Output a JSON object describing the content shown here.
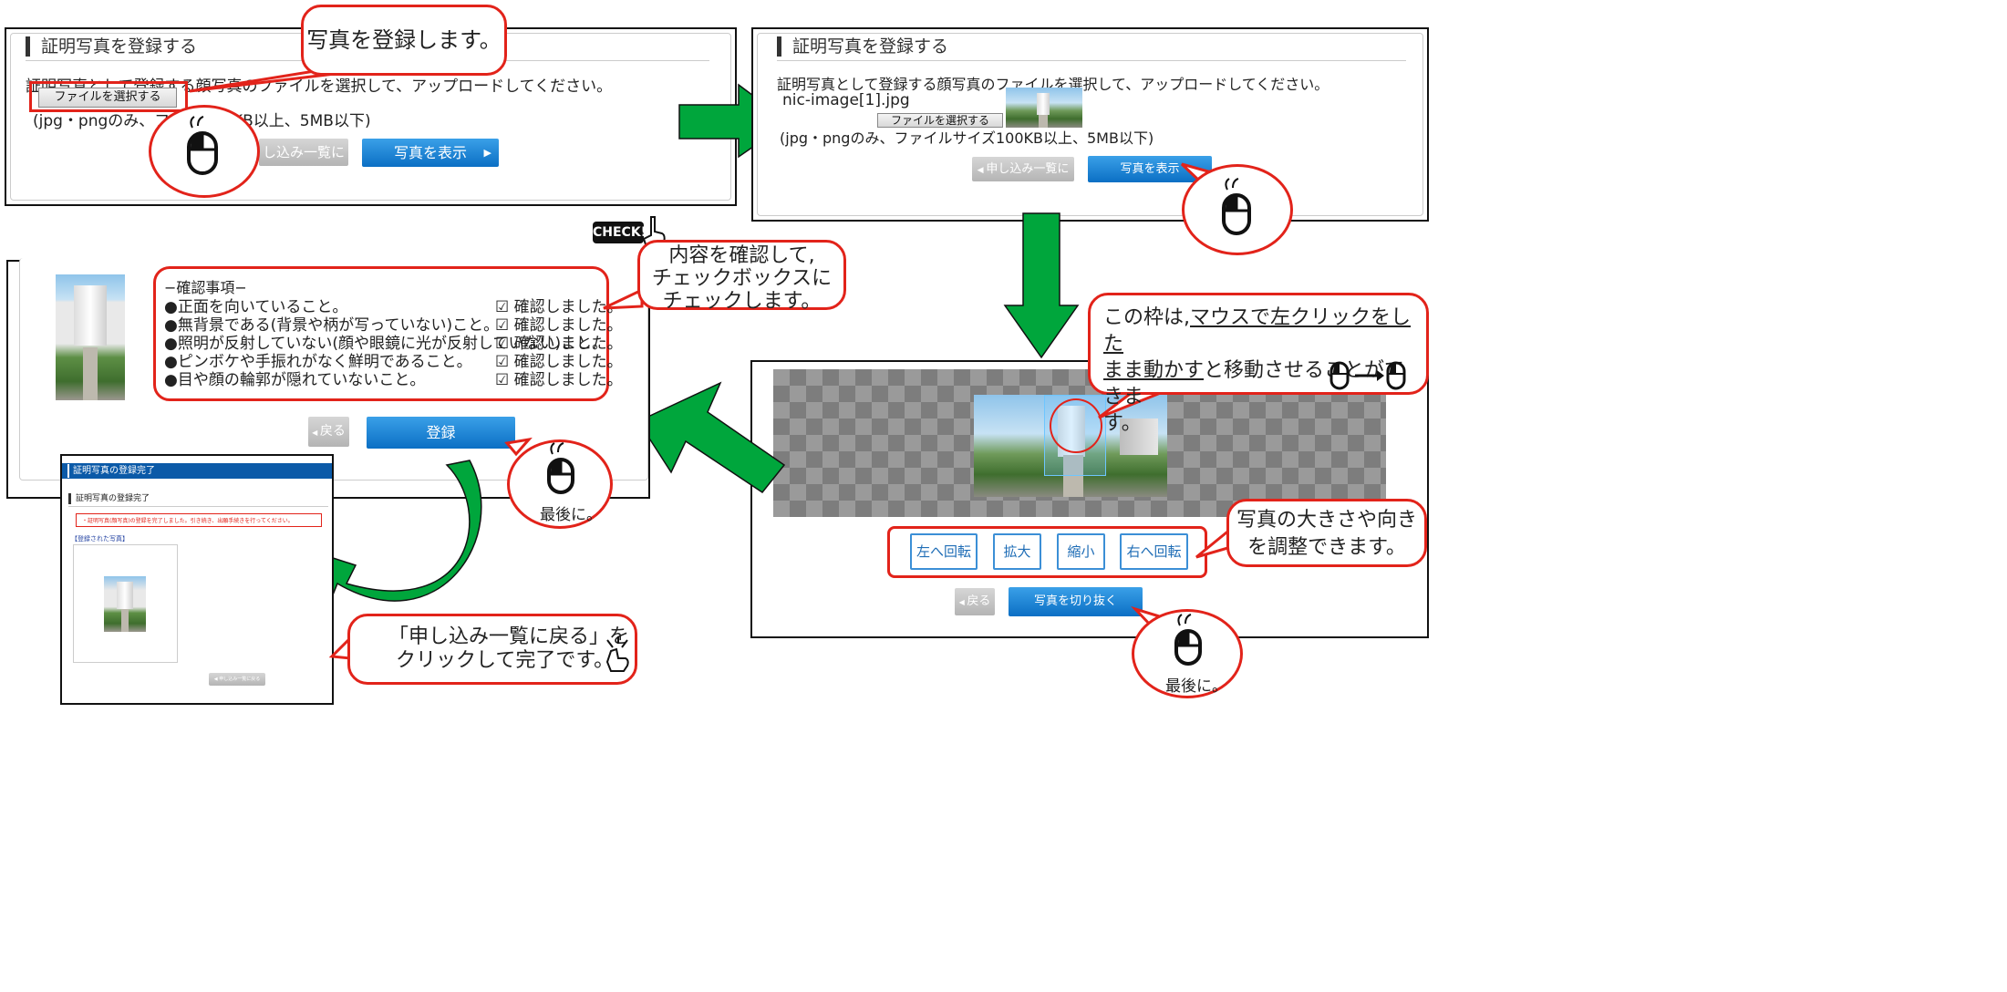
{
  "colors": {
    "callout_border": "#e2231a",
    "arrow_green": "#00a63c",
    "button_blue": "#0b6fc4"
  },
  "step1": {
    "title": "証明写真を登録する",
    "instruction": "証明写真として登録する顔写真のファイルを選択して、アップロードしてください。",
    "file_button": "ファイルを選択する",
    "hint": "(jpg・pngのみ、ファイ",
    "hint_tail": "KB以上、5MB以下)",
    "back_button": "し込み一覧に戻る",
    "show_button": "写真を表示",
    "callout": "写真を登録します。"
  },
  "step2": {
    "title": "証明写真を登録する",
    "instruction": "証明写真として登録する顔写真のファイルを選択して、アップロードしてください。",
    "filename": "nic-image[1].jpg",
    "file_button": "ファイルを選択する",
    "hint": "(jpg・pngのみ、ファイルサイズ100KB以上、5MB以下)",
    "back_button": "申し込み一覧に戻る",
    "show_button": "写真を表示"
  },
  "step3": {
    "callout": "この枠は,マウスで左クリックをしたまま動かすと移動させることができます。",
    "callout_lines": [
      "この枠は,",
      "マウスで左クリックをした",
      "まま動かす",
      "と移動させることができま",
      "す。"
    ],
    "buttons": [
      "左へ回転",
      "拡大",
      "縮小",
      "右へ回転"
    ],
    "adjust_callout": [
      "写真の大きさや向き",
      "を調整できます。"
    ],
    "back_button": "戻る",
    "crop_button": "写真を切り抜く",
    "last_label": "最後に。"
  },
  "step4": {
    "check_badge": "CHECK!",
    "callout": [
      "内容を確認して,",
      "チェックボックスに",
      "チェックします。"
    ],
    "heading": "−確認事項−",
    "items": [
      "●正面を向いていること。",
      "●無背景である(背景や柄が写っていない)こと。",
      "●照明が反射していない(顔や眼鏡に光が反射していない)こと。",
      "●ピンボケや手振れがなく鮮明であること。",
      "●目や顔の輪郭が隠れていないこと。"
    ],
    "confirm_label": "☑ 確認しました。",
    "back_button": "戻る",
    "register_button": "登録",
    "last_label": "最後に。"
  },
  "step5": {
    "header": "証明写真の登録完了",
    "title": "証明写真の登録完了",
    "notice": "・証明写真(顔写真)の登録を完了しました。引き続き、出願手続きを行ってください。",
    "registered_label": "【登録された写真】",
    "back_button": "申し込み一覧に戻る",
    "callout": [
      "「申し込み一覧に戻る」を",
      "クリックして完了です。"
    ]
  }
}
